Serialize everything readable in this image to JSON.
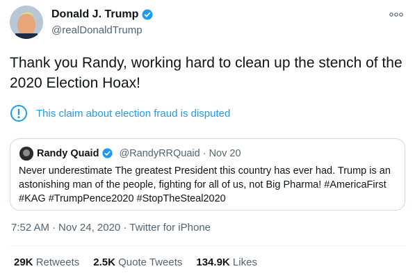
{
  "author": {
    "display_name": "Donald J. Trump",
    "handle": "@realDonaldTrump"
  },
  "tweet": {
    "text": "Thank you Randy, working hard to clean up the stench of the 2020 Election Hoax!"
  },
  "notice": {
    "text": "This claim about election fraud is disputed"
  },
  "quoted_tweet": {
    "display_name": "Randy Quaid",
    "handle": "@RandyRRQuaid",
    "separator": "·",
    "date": "Nov 20",
    "text": "Never underestimate The greatest President this country has ever had. Trump is an astonishing man of the people, fighting for all of us, not Big Pharma! #AmericaFirst #KAG #TrumpPence2020 #StopTheSteal2020"
  },
  "meta": {
    "time": "7:52 AM",
    "sep1": "·",
    "date": "Nov 24, 2020",
    "sep2": "·",
    "source": "Twitter for iPhone"
  },
  "stats": {
    "retweets_count": "29K",
    "retweets_label": "Retweets",
    "quotes_count": "2.5K",
    "quotes_label": "Quote Tweets",
    "likes_count": "134.9K",
    "likes_label": "Likes"
  },
  "colors": {
    "accent": "#1d9bf0",
    "secondary_text": "#536471"
  },
  "icons": {
    "verified": "verified-badge-icon",
    "more": "more-options-icon",
    "notice": "exclamation-circle-icon"
  }
}
